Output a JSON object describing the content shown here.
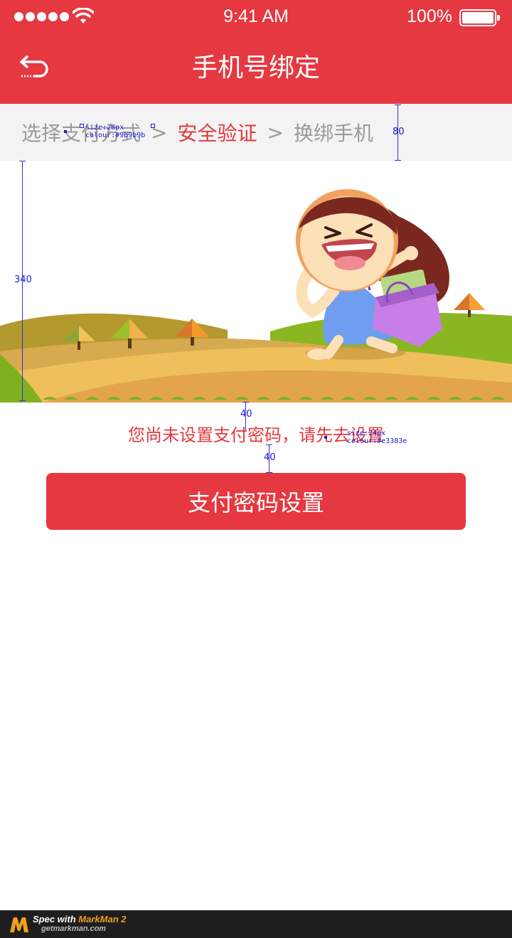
{
  "status_bar": {
    "time": "9:41 AM",
    "battery": "100%",
    "icons": [
      "signal-dots",
      "wifi-icon",
      "battery-icon"
    ]
  },
  "nav": {
    "back_icon": "back-arrow-icon",
    "title": "手机号绑定"
  },
  "steps": {
    "items": [
      "选择支付方式",
      "安全验证",
      "换绑手机"
    ],
    "separator": ">",
    "active_index": 1
  },
  "illustration": {
    "description_icon": "girl-with-shopping-bag-illustration"
  },
  "notice": "您尚未设置支付密码，请先去设置",
  "primary_button": "支付密码设置",
  "spec": {
    "steps_font": "size:28px",
    "steps_color": "colour:#9b9b9b",
    "notice_font": "size:24px",
    "notice_color": "colour:#e3383e",
    "steps_height": "80",
    "illustration_height": "340",
    "gap_top": "40",
    "gap_bottom": "40"
  },
  "footer": {
    "line1_prefix": "Spec with ",
    "line1_brand": "MarkMan 2",
    "line2": "getmarkman.com"
  },
  "colors": {
    "primary": "#e63840",
    "active_text": "#e3383e",
    "muted_text": "#9b9b9b",
    "step_bg": "#f3f3f3"
  }
}
